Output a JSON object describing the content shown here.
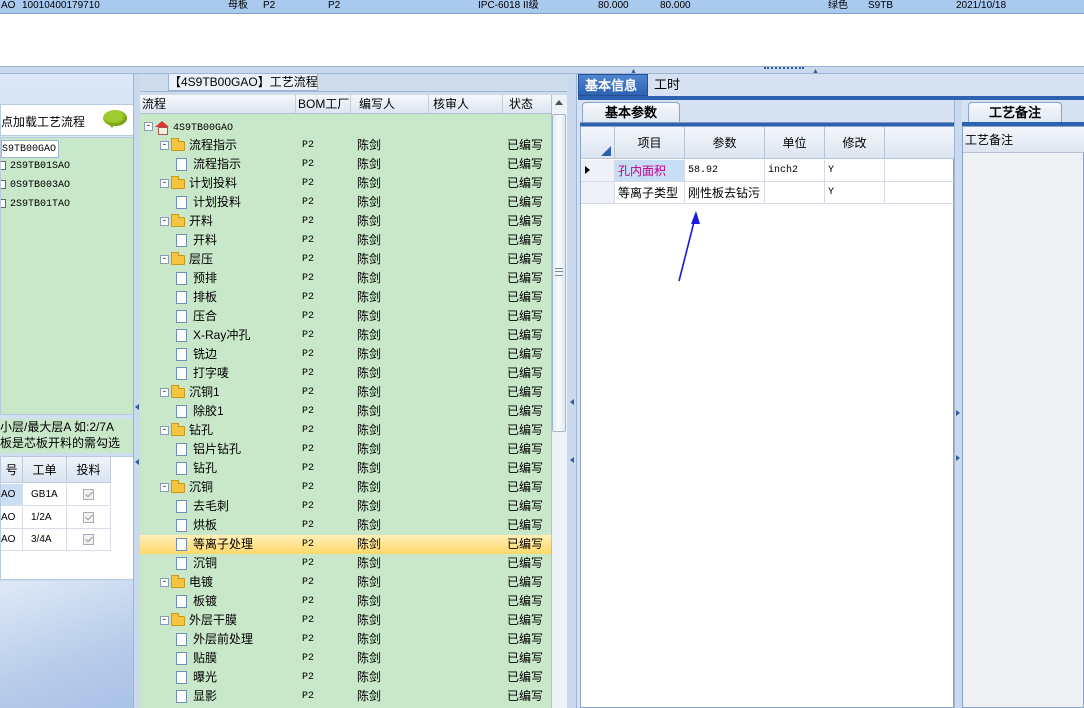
{
  "top_row": {
    "cells": [
      "AO",
      "10010400179710",
      "母板",
      "P2",
      "P2",
      "IPC-6018 II级",
      "80.000",
      "80.000",
      "绿色",
      "S9TB",
      "2021/10/18"
    ]
  },
  "left": {
    "load_label": "点加载工艺流程",
    "items": [
      "S9TB00GAO",
      "2S9TB01SAO",
      "0S9TB003AO",
      "2S9TB01TAO"
    ],
    "note_line1": "小层/最大层A 如:2/7A",
    "note_line2": "板是芯板开料的需勾选",
    "table": {
      "headers": [
        "号",
        "工单",
        "投料"
      ],
      "rows": [
        {
          "no": "AO",
          "order": "GB1A"
        },
        {
          "no": "AO",
          "order": "1/2A"
        },
        {
          "no": "AO",
          "order": "3/4A"
        }
      ]
    }
  },
  "middle": {
    "title": "【4S9TB00GAO】工艺流程",
    "headers": [
      "流程",
      "BOM工厂",
      "编写人",
      "核审人",
      "状态"
    ],
    "root": "4S9TB00GAO",
    "rows": [
      {
        "name": "流程指示",
        "type": "folder",
        "factory": "P2",
        "writer": "陈剑",
        "status": "已编写"
      },
      {
        "name": "流程指示",
        "type": "doc",
        "factory": "P2",
        "writer": "陈剑",
        "status": "已编写"
      },
      {
        "name": "计划投料",
        "type": "folder",
        "factory": "P2",
        "writer": "陈剑",
        "status": "已编写"
      },
      {
        "name": "计划投料",
        "type": "doc",
        "factory": "P2",
        "writer": "陈剑",
        "status": "已编写"
      },
      {
        "name": "开料",
        "type": "folder",
        "factory": "P2",
        "writer": "陈剑",
        "status": "已编写"
      },
      {
        "name": "开料",
        "type": "doc",
        "factory": "P2",
        "writer": "陈剑",
        "status": "已编写"
      },
      {
        "name": "层压",
        "type": "folder",
        "factory": "P2",
        "writer": "陈剑",
        "status": "已编写"
      },
      {
        "name": "预排",
        "type": "doc",
        "factory": "P2",
        "writer": "陈剑",
        "status": "已编写"
      },
      {
        "name": "排板",
        "type": "doc",
        "factory": "P2",
        "writer": "陈剑",
        "status": "已编写"
      },
      {
        "name": "压合",
        "type": "doc",
        "factory": "P2",
        "writer": "陈剑",
        "status": "已编写"
      },
      {
        "name": "X-Ray冲孔",
        "type": "doc",
        "factory": "P2",
        "writer": "陈剑",
        "status": "已编写"
      },
      {
        "name": "铣边",
        "type": "doc",
        "factory": "P2",
        "writer": "陈剑",
        "status": "已编写"
      },
      {
        "name": "打字唛",
        "type": "doc",
        "factory": "P2",
        "writer": "陈剑",
        "status": "已编写"
      },
      {
        "name": "沉铜1",
        "type": "folder",
        "factory": "P2",
        "writer": "陈剑",
        "status": "已编写"
      },
      {
        "name": "除胶1",
        "type": "doc",
        "factory": "P2",
        "writer": "陈剑",
        "status": "已编写"
      },
      {
        "name": "钻孔",
        "type": "folder",
        "factory": "P2",
        "writer": "陈剑",
        "status": "已编写"
      },
      {
        "name": "铝片钻孔",
        "type": "doc",
        "factory": "P2",
        "writer": "陈剑",
        "status": "已编写"
      },
      {
        "name": "钻孔",
        "type": "doc",
        "factory": "P2",
        "writer": "陈剑",
        "status": "已编写"
      },
      {
        "name": "沉铜",
        "type": "folder",
        "factory": "P2",
        "writer": "陈剑",
        "status": "已编写"
      },
      {
        "name": "去毛刺",
        "type": "doc",
        "factory": "P2",
        "writer": "陈剑",
        "status": "已编写"
      },
      {
        "name": "烘板",
        "type": "doc",
        "factory": "P2",
        "writer": "陈剑",
        "status": "已编写"
      },
      {
        "name": "等离子处理",
        "type": "doc",
        "factory": "P2",
        "writer": "陈剑",
        "status": "已编写",
        "selected": true
      },
      {
        "name": "沉铜",
        "type": "doc",
        "factory": "P2",
        "writer": "陈剑",
        "status": "已编写"
      },
      {
        "name": "电镀",
        "type": "folder",
        "factory": "P2",
        "writer": "陈剑",
        "status": "已编写"
      },
      {
        "name": "板镀",
        "type": "doc",
        "factory": "P2",
        "writer": "陈剑",
        "status": "已编写"
      },
      {
        "name": "外层干膜",
        "type": "folder",
        "factory": "P2",
        "writer": "陈剑",
        "status": "已编写"
      },
      {
        "name": "外层前处理",
        "type": "doc",
        "factory": "P2",
        "writer": "陈剑",
        "status": "已编写"
      },
      {
        "name": "贴膜",
        "type": "doc",
        "factory": "P2",
        "writer": "陈剑",
        "status": "已编写"
      },
      {
        "name": "曝光",
        "type": "doc",
        "factory": "P2",
        "writer": "陈剑",
        "status": "已编写"
      },
      {
        "name": "显影",
        "type": "doc",
        "factory": "P2",
        "writer": "陈剑",
        "status": "已编写"
      }
    ]
  },
  "right": {
    "tabs": [
      "基本信息",
      "工时"
    ],
    "subtab": "基本参数",
    "grid_headers": [
      "项目",
      "参数",
      "单位",
      "修改"
    ],
    "grid_rows": [
      {
        "item": "孔内面积",
        "param": "58.92",
        "unit": "inch2",
        "modify": "Y"
      },
      {
        "item": "等离子类型",
        "param": "刚性板去钻污",
        "unit": "",
        "modify": "Y"
      }
    ],
    "remark_tab": "工艺备注",
    "remark_header": "工艺备注"
  },
  "colors": {
    "accent": "#2d62b3",
    "tree_bg": "#c9e7c9",
    "selected_row": "#ffd86a",
    "link_item": "#c0008a",
    "arrow": "#1a1adc"
  }
}
